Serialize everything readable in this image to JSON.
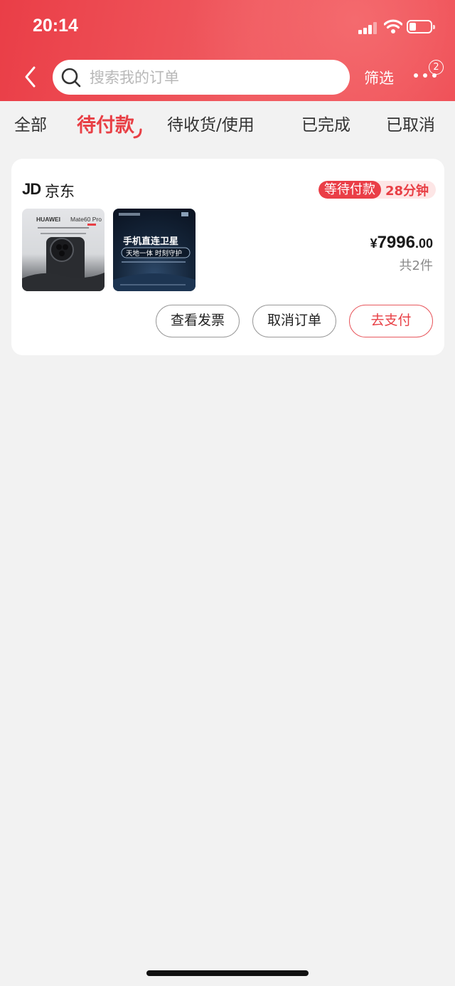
{
  "status_bar": {
    "time": "20:14"
  },
  "header": {
    "search_placeholder": "搜索我的订单",
    "filter_label": "筛选",
    "more_badge": "2"
  },
  "tabs": [
    {
      "label": "全部"
    },
    {
      "label": "待付款"
    },
    {
      "label": "待收货/使用"
    },
    {
      "label": "已完成"
    },
    {
      "label": "已取消"
    }
  ],
  "order": {
    "shop_logo": "JD",
    "shop_name": "京东",
    "status": "等待付款",
    "countdown": "28分钟",
    "products": [
      {
        "brand": "HUAWEI",
        "model": "Mate60 Pro"
      },
      {
        "title": "手机直连卫星",
        "subtitle": "天地一体 时刻守护"
      }
    ],
    "price_currency": "¥",
    "price_integer": "7996",
    "price_decimal": ".00",
    "item_count": "共2件",
    "buttons": {
      "invoice": "查看发票",
      "cancel": "取消订单",
      "pay": "去支付"
    }
  },
  "colors": {
    "accent": "#e83f45",
    "header_bg": "#ee4a52",
    "page_bg": "#f2f2f2"
  }
}
